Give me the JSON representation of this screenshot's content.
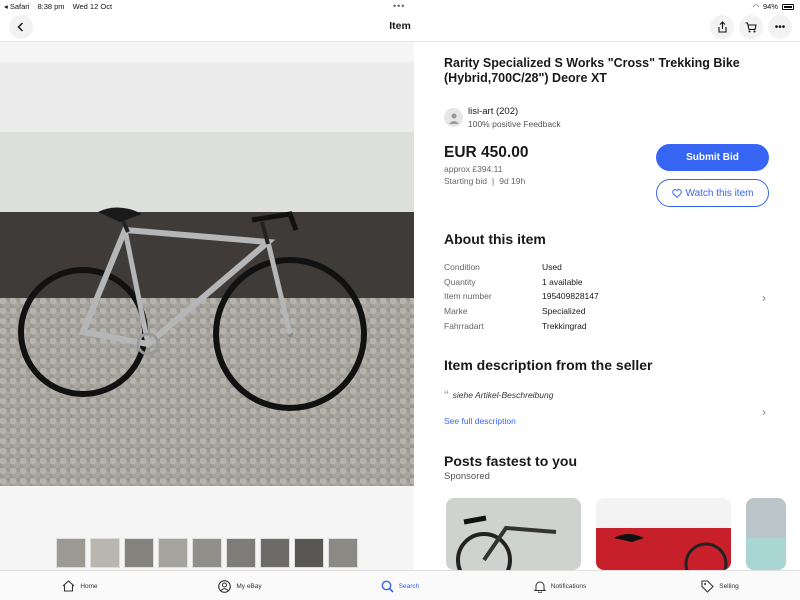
{
  "status_bar": {
    "back_app": "Safari",
    "time": "8:38 pm",
    "date": "Wed 12 Oct",
    "battery": "94%"
  },
  "nav": {
    "title": "Item"
  },
  "listing": {
    "title": "Rarity Specialized S Works \"Cross\" Trekking Bike (Hybrid,700C/28\") Deore XT",
    "seller": {
      "name": "lisi-art (202)",
      "feedback": "100% positive Feedback"
    },
    "price": "EUR 450.00",
    "approx": "approx £394.11",
    "bid_label": "Starting bid",
    "time_left": "9d 19h",
    "submit_bid": "Submit Bid",
    "watch": "Watch this item"
  },
  "about": {
    "heading": "About this item",
    "rows": [
      {
        "key": "Condition",
        "value": "Used"
      },
      {
        "key": "Quantity",
        "value": "1 available"
      },
      {
        "key": "Item number",
        "value": "195409828147"
      },
      {
        "key": "Marke",
        "value": "Specialized"
      },
      {
        "key": "Fahrradart",
        "value": "Trekkingrad"
      }
    ]
  },
  "description": {
    "heading": "Item description from the seller",
    "quote": "siehe Artikel-Beschreibung",
    "see_full": "See full description"
  },
  "posts": {
    "heading": "Posts fastest to you",
    "sponsored": "Sponsored"
  },
  "tabs": [
    {
      "label": "Home",
      "icon": "home-icon"
    },
    {
      "label": "My eBay",
      "icon": "user-icon"
    },
    {
      "label": "Search",
      "icon": "search-icon"
    },
    {
      "label": "Notifications",
      "icon": "bell-icon"
    },
    {
      "label": "Selling",
      "icon": "tag-icon"
    }
  ],
  "colors": {
    "accent": "#3665f3",
    "text": "#191919",
    "muted": "#666666"
  }
}
